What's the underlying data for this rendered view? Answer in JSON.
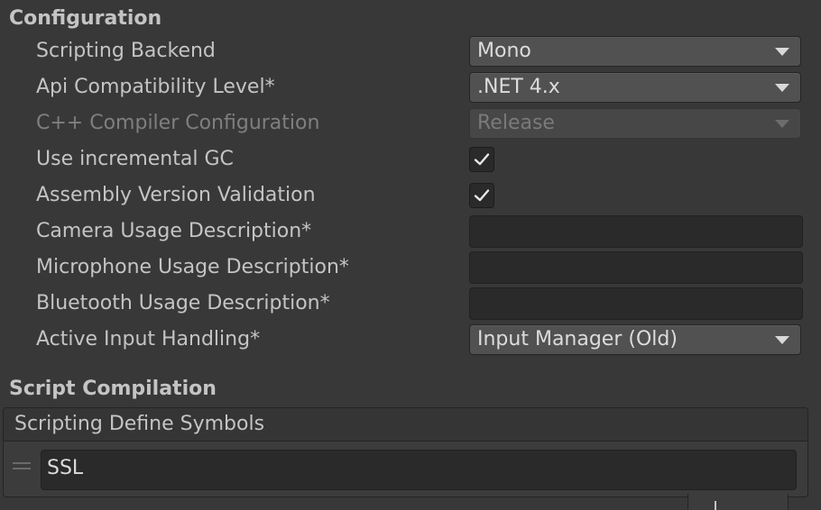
{
  "configuration": {
    "header": "Configuration",
    "rows": {
      "scripting_backend": {
        "label": "Scripting Backend",
        "value": "Mono"
      },
      "api_compat": {
        "label": "Api Compatibility Level*",
        "value": ".NET 4.x"
      },
      "cpp_compiler": {
        "label": "C++ Compiler Configuration",
        "value": "Release",
        "disabled": true
      },
      "incremental_gc": {
        "label": "Use incremental GC",
        "checked": true
      },
      "assembly_validation": {
        "label": "Assembly Version Validation",
        "checked": true
      },
      "camera_usage": {
        "label": "Camera Usage Description*",
        "value": ""
      },
      "microphone_usage": {
        "label": "Microphone Usage Description*",
        "value": ""
      },
      "bluetooth_usage": {
        "label": "Bluetooth Usage Description*",
        "value": ""
      },
      "input_handling": {
        "label": "Active Input Handling*",
        "value": "Input Manager (Old)"
      }
    }
  },
  "script_compilation": {
    "header": "Script Compilation",
    "define_symbols": {
      "title": "Scripting Define Symbols",
      "items": [
        "SSL"
      ]
    }
  },
  "icons": {
    "dropdown": "chevron-down-icon",
    "check": "checkmark-icon",
    "drag": "drag-handle-icon",
    "add": "plus-icon"
  }
}
